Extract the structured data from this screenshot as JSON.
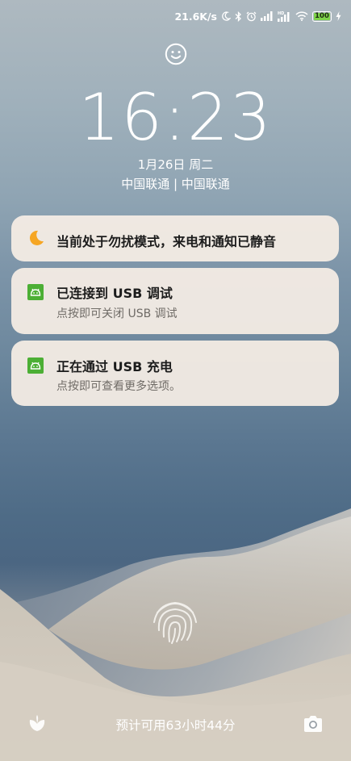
{
  "status_bar": {
    "net_speed": "21.6K/s",
    "battery": "100",
    "icons": [
      "moon-icon",
      "bluetooth-icon",
      "alarm-icon",
      "signal-icon",
      "signal-hd-icon",
      "wifi-icon",
      "battery-icon",
      "charging-icon"
    ]
  },
  "lock": {
    "time": "16:23",
    "date": "1月26日 周二",
    "carriers": "中国联通 | 中国联通"
  },
  "notifications": [
    {
      "icon": "moon-icon",
      "title": "当前处于勿扰模式，来电和通知已静音",
      "subtitle": ""
    },
    {
      "icon": "android-debug-icon",
      "title": "已连接到 USB 调试",
      "subtitle": "点按即可关闭 USB 调试"
    },
    {
      "icon": "android-debug-icon",
      "title": "正在通过 USB 充电",
      "subtitle": "点按即可查看更多选项。"
    }
  ],
  "bottom": {
    "battery_estimate": "预计可用63小时44分",
    "left_icon": "leaf-icon",
    "right_icon": "camera-icon"
  },
  "colors": {
    "notification_bg": "#F6EEE5",
    "battery_green": "#7ED34A",
    "dnd_moon": "#F6A623",
    "android_green": "#4CAF35"
  }
}
